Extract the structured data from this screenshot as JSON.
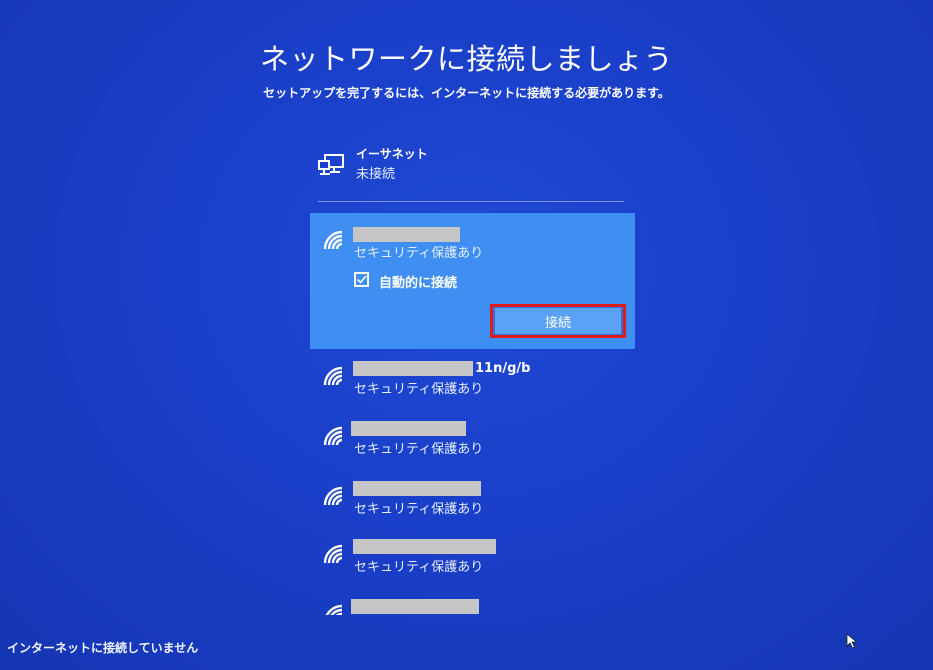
{
  "page": {
    "title": "ネットワークに接続しましょう",
    "subtitle": "セットアップを完了するには、インターネットに接続する必要があります。"
  },
  "ethernet": {
    "icon": "ethernet-icon",
    "name": "イーサネット",
    "status": "未接続"
  },
  "networks": [
    {
      "icon": "wifi-icon",
      "ssid_suffix": "",
      "security": "セキュリティ保護あり",
      "selected": true,
      "auto_connect_label": "自動的に接続",
      "auto_connect_checked": true,
      "connect_label": "接続"
    },
    {
      "icon": "wifi-icon",
      "ssid_suffix": "11n/g/b",
      "security": "セキュリティ保護あり"
    },
    {
      "icon": "wifi-icon",
      "ssid_suffix": "",
      "security": "セキュリティ保護あり"
    },
    {
      "icon": "wifi-icon",
      "ssid_suffix": "",
      "security": "セキュリティ保護あり"
    },
    {
      "icon": "wifi-icon",
      "ssid_suffix": "",
      "security": "セキュリティ保護あり"
    },
    {
      "icon": "wifi-icon",
      "ssid_suffix": "",
      "security": ""
    }
  ],
  "footer": {
    "status": "インターネットに接続していません"
  },
  "colors": {
    "background": "#1a3fc8",
    "selected_item": "#3f8ef2",
    "button": "#5aa2f6",
    "highlight_border": "#e01b1b"
  }
}
